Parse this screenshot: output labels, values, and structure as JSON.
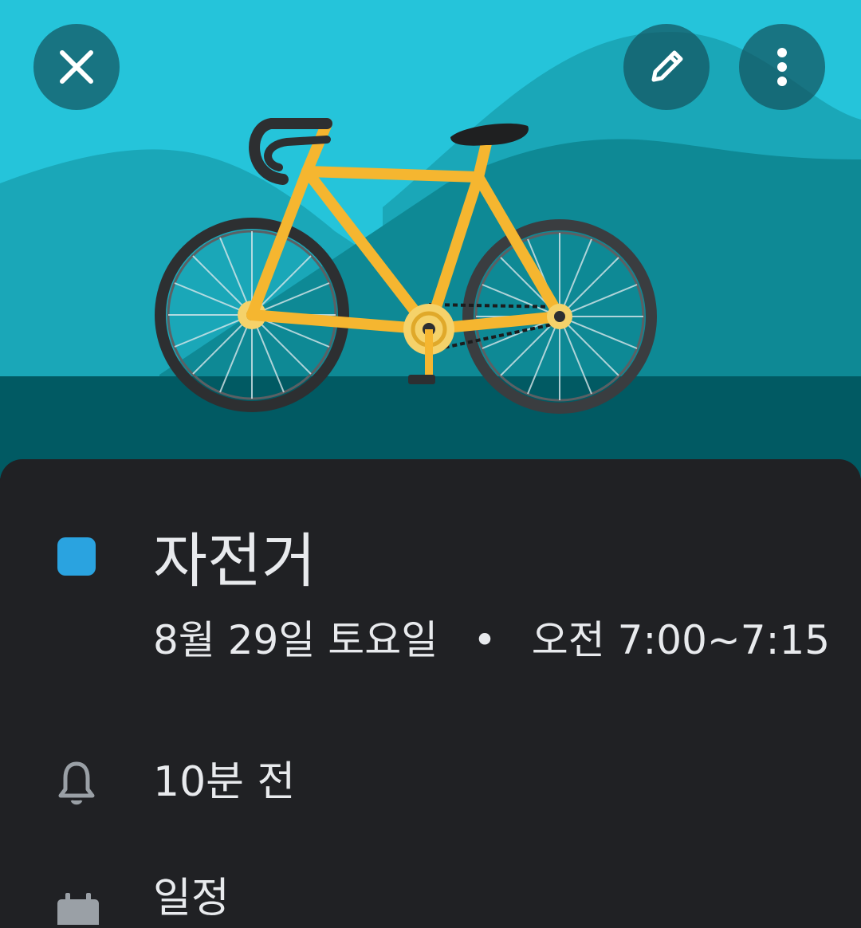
{
  "event": {
    "title": "자전거",
    "date": "8월 29일 토요일",
    "separator": "•",
    "time": "오전 7:00~7:15",
    "color": "#2aa3e0"
  },
  "details": {
    "reminder": "10분 전",
    "calendar": "일정"
  },
  "toolbar": {
    "close_icon": "close-icon",
    "edit_icon": "pencil-icon",
    "more_icon": "more-vertical-icon"
  },
  "colors": {
    "sky": "#25c4da",
    "ground": "#015a63",
    "bike_frame": "#f5b630",
    "sheet_bg": "#202124"
  }
}
